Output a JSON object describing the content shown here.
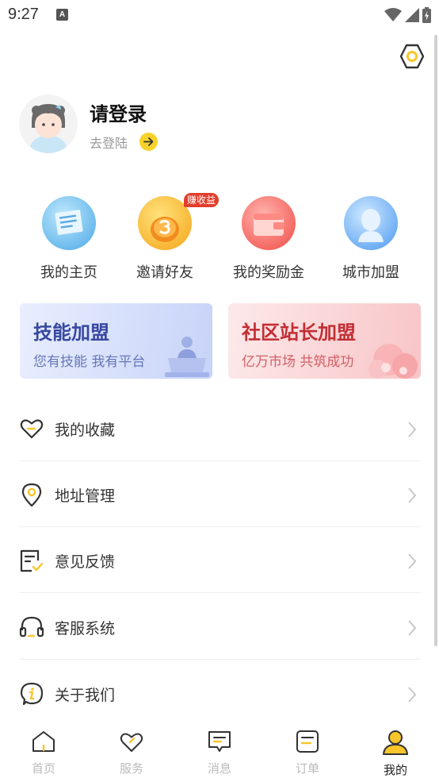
{
  "status_bar": {
    "time": "9:27",
    "notification": "A"
  },
  "profile": {
    "title": "请登录",
    "subtitle": "去登陆"
  },
  "quick_actions": [
    {
      "label": "我的主页",
      "icon": "homepage-icon"
    },
    {
      "label": "邀请好友",
      "icon": "invite-coin-icon",
      "badge": "赚收益"
    },
    {
      "label": "我的奖励金",
      "icon": "wallet-icon"
    },
    {
      "label": "城市加盟",
      "icon": "person-avatar-icon"
    }
  ],
  "banners": [
    {
      "title": "技能加盟",
      "subtitle": "您有技能 我有平台"
    },
    {
      "title": "社区站长加盟",
      "subtitle": "亿万市场 共筑成功"
    }
  ],
  "menu": [
    {
      "label": "我的收藏",
      "icon": "heart-icon"
    },
    {
      "label": "地址管理",
      "icon": "location-pin-icon"
    },
    {
      "label": "意见反馈",
      "icon": "feedback-icon"
    },
    {
      "label": "客服系统",
      "icon": "headset-icon"
    },
    {
      "label": "关于我们",
      "icon": "info-icon"
    }
  ],
  "tabs": [
    {
      "label": "首页",
      "icon": "home-icon",
      "active": false
    },
    {
      "label": "服务",
      "icon": "heart-icon",
      "active": false
    },
    {
      "label": "消息",
      "icon": "message-icon",
      "active": false
    },
    {
      "label": "订单",
      "icon": "order-icon",
      "active": false
    },
    {
      "label": "我的",
      "icon": "user-icon",
      "active": true
    }
  ],
  "colors": {
    "accent": "#f8c62a",
    "icon_dark": "#333333",
    "tab_inactive": "#bbbbbb"
  }
}
